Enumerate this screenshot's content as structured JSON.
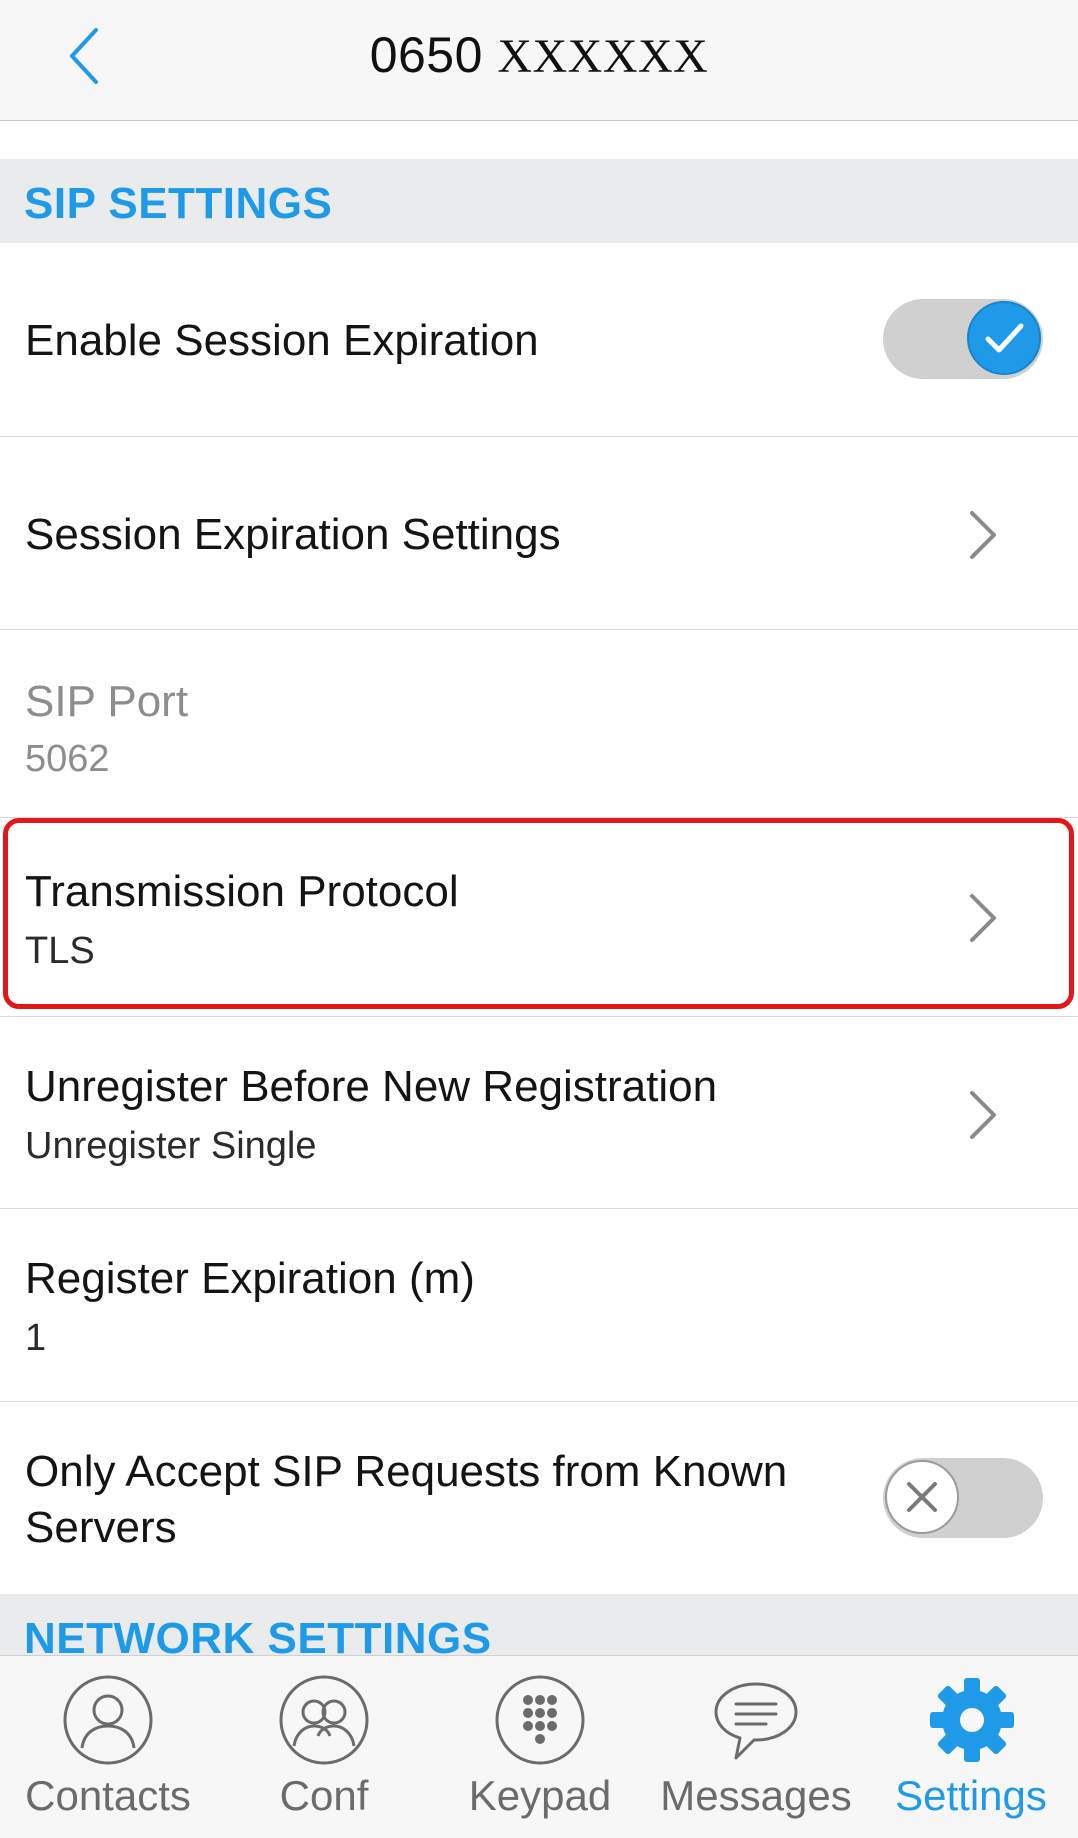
{
  "header": {
    "title_number": "0650",
    "title_masked": "XXXXXX"
  },
  "sections": {
    "sip": "SIP SETTINGS",
    "network": "NETWORK SETTINGS"
  },
  "rows": {
    "enable_session_expiration": {
      "label": "Enable Session Expiration",
      "toggle": "on"
    },
    "session_expiration_settings": {
      "label": "Session Expiration Settings"
    },
    "sip_port": {
      "label": "SIP Port",
      "value": "5062"
    },
    "transmission_protocol": {
      "label": "Transmission Protocol",
      "value": "TLS"
    },
    "unregister_before_new_registration": {
      "label": "Unregister Before New Registration",
      "value": "Unregister Single"
    },
    "register_expiration": {
      "label": "Register Expiration (m)",
      "value": "1"
    },
    "only_accept_known_servers": {
      "label_line1": "Only Accept SIP Requests from Known",
      "label_line2": "Servers",
      "toggle": "off"
    }
  },
  "tabs": [
    {
      "label": "Contacts",
      "icon": "contacts-icon"
    },
    {
      "label": "Conf",
      "icon": "conference-icon"
    },
    {
      "label": "Keypad",
      "icon": "keypad-icon"
    },
    {
      "label": "Messages",
      "icon": "messages-icon"
    },
    {
      "label": "Settings",
      "icon": "gear-icon",
      "active": true
    }
  ],
  "colors": {
    "accent": "#1e9ae8",
    "highlight": "#e4161a",
    "section_bg": "#e9ebed"
  }
}
